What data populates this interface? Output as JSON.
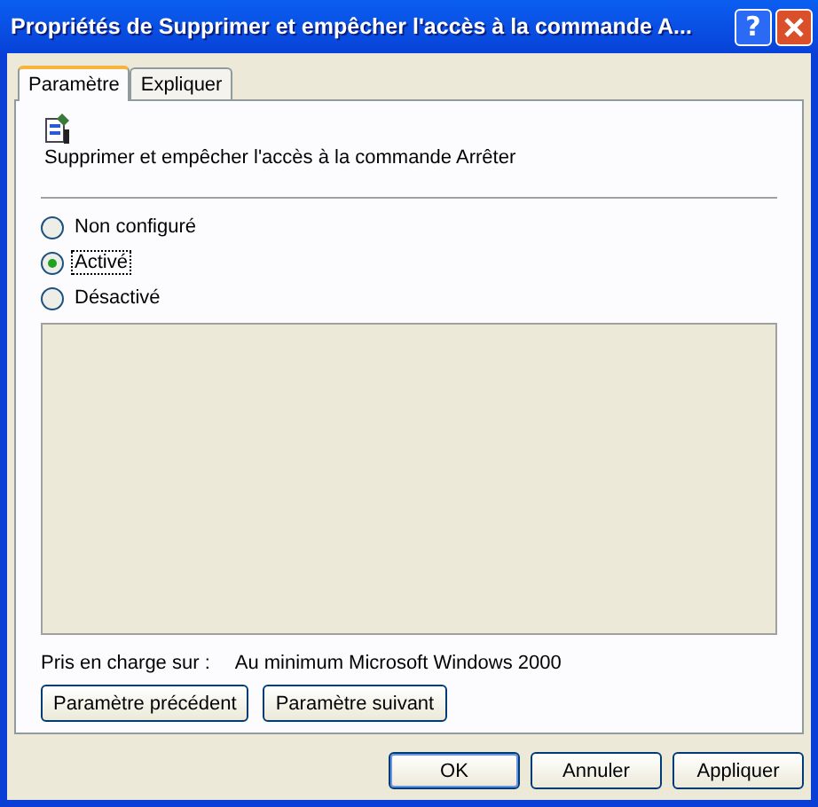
{
  "window": {
    "title": "Propriétés de Supprimer et empêcher l'accès à la commande A..."
  },
  "title_buttons": [
    {
      "kind": "help",
      "label": "?"
    },
    {
      "kind": "close"
    }
  ],
  "tabs": [
    {
      "label": "Paramètre",
      "selected": true
    },
    {
      "label": "Expliquer",
      "selected": false
    }
  ],
  "policy": {
    "name": "Supprimer et empêcher l'accès à la commande Arrêter"
  },
  "options": [
    {
      "label": "Non configuré",
      "selected": false
    },
    {
      "label": "Activé",
      "selected": true
    },
    {
      "label": "Désactivé",
      "selected": false
    }
  ],
  "supported": {
    "label": "Pris en charge sur :",
    "value": "Au minimum Microsoft Windows 2000"
  },
  "nav_buttons": [
    "Paramètre précédent",
    "Paramètre suivant"
  ],
  "buttons": [
    "OK",
    "Annuler",
    "Appliquer"
  ]
}
